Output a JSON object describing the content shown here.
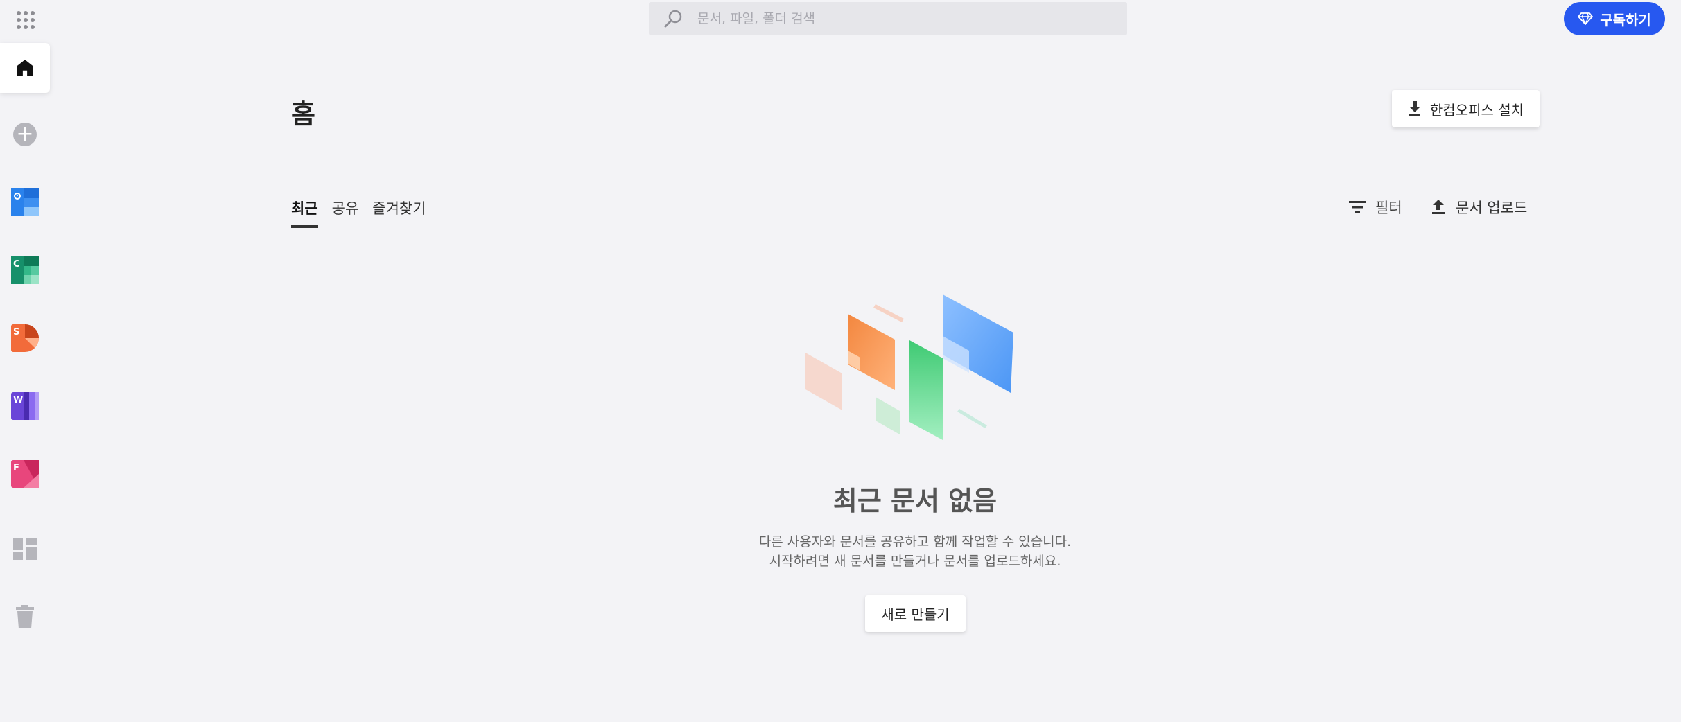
{
  "topbar": {
    "search_placeholder": "문서, 파일, 폴더 검색",
    "subscribe_label": "구독하기"
  },
  "sidebar": {
    "items": [
      {
        "name": "home",
        "icon": "home-icon"
      },
      {
        "name": "new",
        "icon": "plus-circle-icon"
      },
      {
        "name": "calendar",
        "icon": "calendar-app-icon",
        "letter": ""
      },
      {
        "name": "cell",
        "icon": "cell-app-icon",
        "letter": "C"
      },
      {
        "name": "show",
        "icon": "show-app-icon",
        "letter": "S"
      },
      {
        "name": "word",
        "icon": "word-app-icon",
        "letter": "W"
      },
      {
        "name": "form",
        "icon": "form-app-icon",
        "letter": "F"
      },
      {
        "name": "templates",
        "icon": "dashboard-icon"
      },
      {
        "name": "trash",
        "icon": "trash-icon"
      }
    ]
  },
  "page": {
    "title": "홈",
    "install_label": "한컴오피스 설치"
  },
  "tabs": [
    {
      "label": "최근",
      "active": true
    },
    {
      "label": "공유",
      "active": false
    },
    {
      "label": "즐겨찾기",
      "active": false
    }
  ],
  "tools": {
    "filter_label": "필터",
    "upload_label": "문서 업로드"
  },
  "empty_state": {
    "title": "최근 문서 없음",
    "line1": "다른 사용자와 문서를 공유하고 함께 작업할 수 있습니다.",
    "line2": "시작하려면 새 문서를 만들거나 문서를 업로드하세요.",
    "button_label": "새로 만들기"
  },
  "colors": {
    "accent": "#2758f0",
    "background": "#f3f3f6",
    "cell": "#1fa67a",
    "show": "#f26b3a",
    "word": "#6a45d8",
    "form": "#e8467c",
    "calendar": "#3d8ff0"
  }
}
